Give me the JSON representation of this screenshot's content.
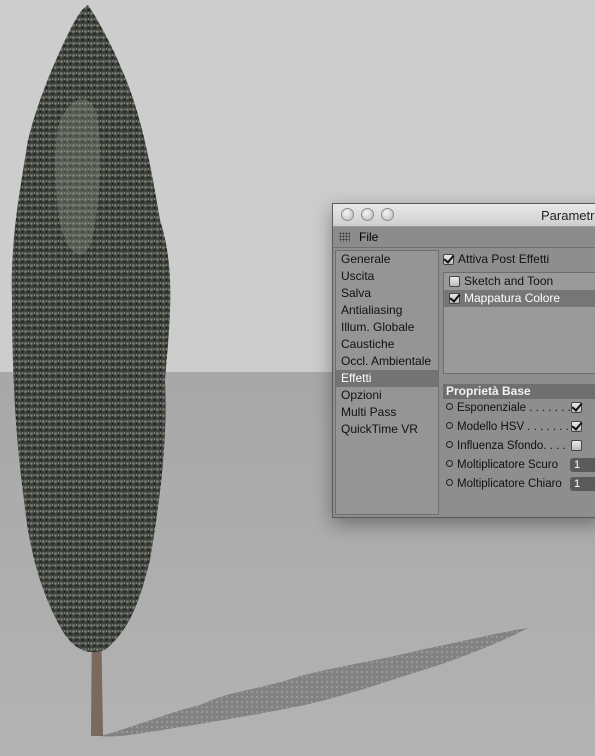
{
  "window": {
    "title": "Parametri",
    "menu_file": "File"
  },
  "nav": {
    "items": [
      {
        "label": "Generale"
      },
      {
        "label": "Uscita"
      },
      {
        "label": "Salva"
      },
      {
        "label": "Antialiasing"
      },
      {
        "label": "Illum. Globale"
      },
      {
        "label": "Caustiche"
      },
      {
        "label": "Occl. Ambientale"
      },
      {
        "label": "Effetti",
        "selected": true
      },
      {
        "label": "Opzioni"
      },
      {
        "label": "Multi Pass"
      },
      {
        "label": "QuickTime VR"
      }
    ]
  },
  "post_effects": {
    "label": "Attiva Post Effetti",
    "checked": true,
    "list": [
      {
        "label": "Sketch and Toon",
        "checked": false
      },
      {
        "label": "Mappatura Colore",
        "checked": true,
        "selected": true
      }
    ]
  },
  "properties": {
    "header": "Proprietà Base",
    "rows": [
      {
        "label": "Esponenziale . . . . . . .",
        "type": "checkbox",
        "checked": true
      },
      {
        "label": "Modello HSV . . . . . . .",
        "type": "checkbox",
        "checked": true
      },
      {
        "label": "Influenza Sfondo. . . .",
        "type": "checkbox",
        "checked": false
      },
      {
        "label": "Moltiplicatore Scuro",
        "type": "number",
        "value": "1"
      },
      {
        "label": "Moltiplicatore Chiaro",
        "type": "number",
        "value": "1"
      }
    ]
  },
  "colors": {
    "wall": "#cdcdcd",
    "floor": "#a9a9a9",
    "foliage_dark": "#2d302c",
    "foliage_mid": "#5b6058",
    "trunk": "#7a6a5e"
  }
}
